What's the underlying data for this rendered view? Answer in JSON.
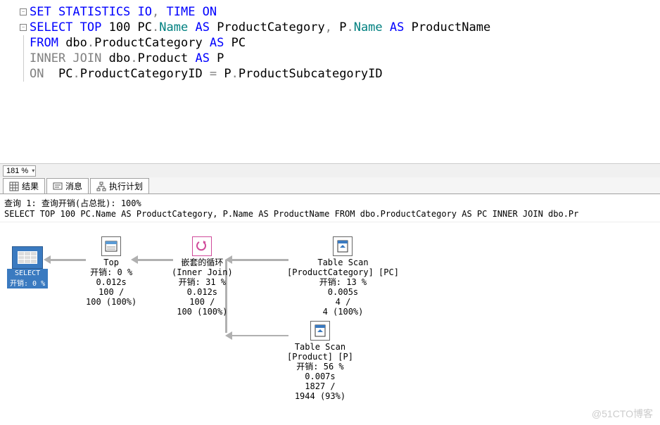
{
  "code": {
    "line1": {
      "a": "SET STATISTICS IO",
      "b": ", ",
      "c": "TIME ON"
    },
    "line2": {
      "a": "SELECT TOP ",
      "b": "100",
      "c": " PC",
      "d": ".",
      "e": "Name ",
      "f": "AS ",
      "g": "ProductCategory",
      "h": ",",
      "i": " P",
      "j": ".",
      "k": "Name ",
      "l": "AS ",
      "m": "ProductName"
    },
    "line3": {
      "a": "FROM ",
      "b": "dbo",
      "c": ".",
      "d": "ProductCategory ",
      "e": "AS ",
      "f": "PC"
    },
    "line4": {
      "a": "INNER JOIN ",
      "b": "dbo",
      "c": ".",
      "d": "Product ",
      "e": "AS ",
      "f": "P"
    },
    "line5": {
      "a": "ON  ",
      "b": "PC",
      "c": ".",
      "d": "ProductCategoryID ",
      "e": "= ",
      "f": "P",
      "g": ".",
      "h": "ProductSubcategoryID"
    }
  },
  "zoom": "181 %",
  "tabs": {
    "results": "结果",
    "messages": "消息",
    "plan": "执行计划"
  },
  "plan_header": {
    "line1_a": "查询 1: 查询开销(占总批): ",
    "line1_b": "100%",
    "line2": "SELECT TOP 100 PC.Name AS ProductCategory, P.Name AS ProductName FROM dbo.ProductCategory AS PC INNER JOIN dbo.Pr"
  },
  "nodes": {
    "select": {
      "label": "SELECT",
      "cost": "开销: 0 %"
    },
    "top": {
      "title": "Top",
      "cost": "开销: 0 %",
      "time": "0.012s",
      "rows1": "100 /",
      "rows2": "100 (100%)"
    },
    "loop": {
      "title": "嵌套的循环",
      "sub": "(Inner Join)",
      "cost": "开销: 31 %",
      "time": "0.012s",
      "rows1": "100 /",
      "rows2": "100 (100%)"
    },
    "scan1": {
      "title": "Table Scan",
      "sub": "[ProductCategory] [PC]",
      "cost": "开销: 13 %",
      "time": "0.005s",
      "rows1": "4 /",
      "rows2": "4 (100%)"
    },
    "scan2": {
      "title": "Table Scan",
      "sub": "[Product] [P]",
      "cost": "开销: 56 %",
      "time": "0.007s",
      "rows1": "1827 /",
      "rows2": "1944 (93%)"
    }
  },
  "watermark": "@51CTO博客"
}
